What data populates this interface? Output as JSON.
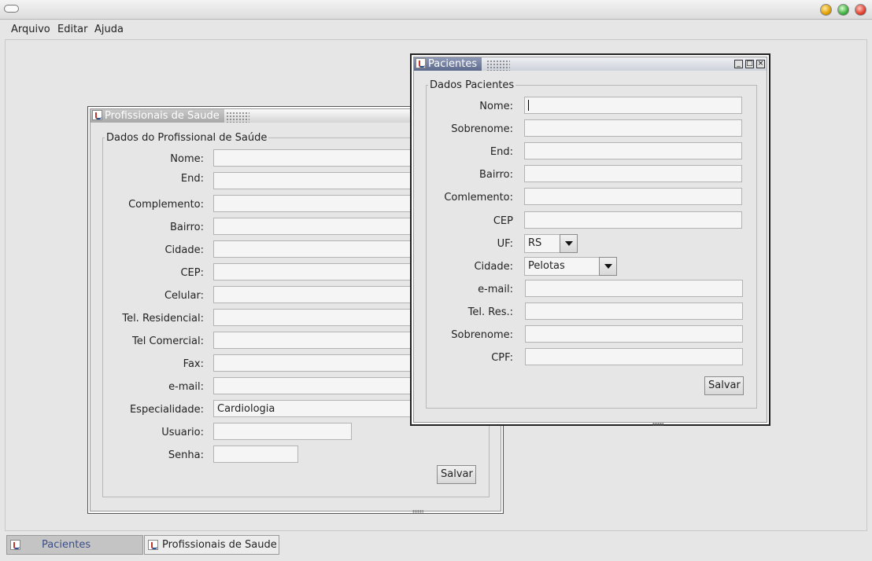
{
  "menu": {
    "items": [
      "Arquivo",
      "Editar",
      "Ajuda"
    ]
  },
  "frames": {
    "profissionais": {
      "title": "Profissionais de Saude",
      "group": "Dados do Profissional de Saúde",
      "labels": [
        "Nome:",
        "End:",
        "Complemento:",
        "Bairro:",
        "Cidade:",
        "CEP:",
        "Celular:",
        "Tel. Residencial:",
        "Tel Comercial:",
        "Fax:",
        "e-mail:",
        "Especialidade:",
        "Usuario:",
        "Senha:"
      ],
      "values": [
        "",
        "",
        "",
        "",
        "",
        "",
        "",
        "",
        "",
        "",
        "",
        "Cardiologia",
        "",
        ""
      ],
      "save": "Salvar"
    },
    "pacientes": {
      "title": "Pacientes",
      "group": "Dados Pacientes",
      "labels": [
        "Nome:",
        "Sobrenome:",
        "End:",
        "Bairro:",
        "Comlemento:",
        "CEP",
        "UF:",
        "Cidade:",
        "e-mail:",
        "Tel. Res.:",
        "Sobrenome:",
        "CPF:"
      ],
      "values": [
        "",
        "",
        "",
        "",
        "",
        "",
        "RS",
        "Pelotas",
        "",
        "",
        "",
        ""
      ],
      "save": "Salvar",
      "controls": {
        "minimize": "_",
        "maximize": "□",
        "close": "×"
      }
    }
  },
  "taskbar": [
    "Pacientes",
    "Profissionais de Saude"
  ],
  "colors": {
    "active_title": "#5d6a8d",
    "desktop": "#e6e6e6",
    "selected_task_text": "#3a4d8a"
  }
}
